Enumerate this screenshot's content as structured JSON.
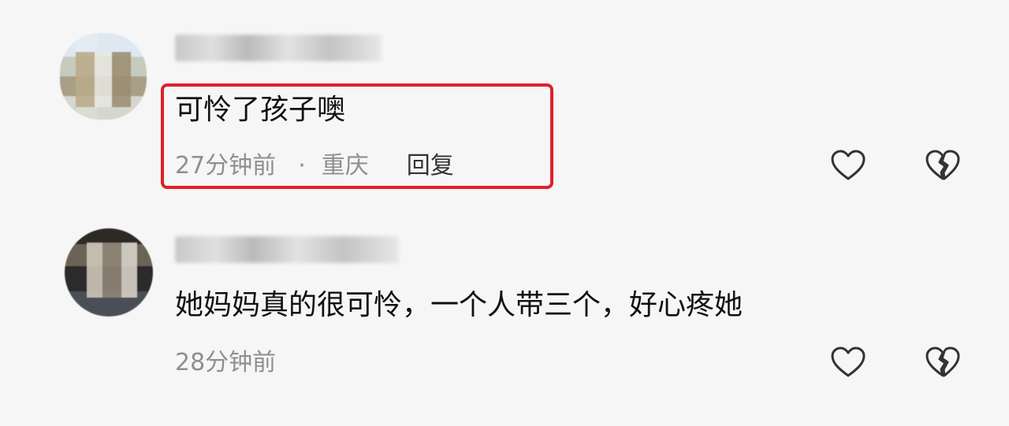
{
  "comments": [
    {
      "text": "可怜了孩子噢",
      "time": "27分钟前",
      "separator": "·",
      "location": "重庆",
      "reply_label": "回复",
      "highlighted": true
    },
    {
      "text": "她妈妈真的很可怜，一个人带三个，好心疼她",
      "time": "28分钟前"
    }
  ],
  "icons": {
    "like": "heart-outline-icon",
    "dislike": "broken-heart-icon"
  },
  "colors": {
    "highlight_border": "#e0202a",
    "meta_text": "#8f8f8f",
    "background": "#f6f6f6"
  }
}
